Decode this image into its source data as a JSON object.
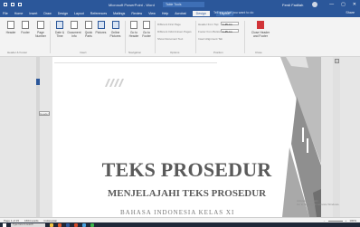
{
  "app": {
    "window_title": "Microsoft PowerPoint - Word",
    "context_tab": "Table Tools",
    "user": "Ferdi Fadilah",
    "window_controls": [
      "—",
      "▢",
      "✕"
    ]
  },
  "tabs": [
    "File",
    "Home",
    "Insert",
    "Draw",
    "Design",
    "Layout",
    "References",
    "Mailings",
    "Review",
    "View",
    "Help",
    "Acrobat",
    "Design",
    "Layout"
  ],
  "tell_me": "Tell me what you want to do",
  "share_label": "Share",
  "ribbon": {
    "buttons": [
      "Header",
      "Footer",
      "Page Number",
      "Date & Time",
      "Document Info",
      "Quick Parts",
      "Pictures",
      "Online Pictures",
      "Go to Header",
      "Go to Footer",
      "Close Header and Footer"
    ],
    "options": [
      "Different First Page",
      "Different Odd & Even Pages",
      "Show Document Text"
    ],
    "position": [
      "Header from Top:",
      "Footer from Bottom:",
      "Insert Alignment Tab"
    ],
    "position_values": [
      "1.25 cm",
      "1.25 cm"
    ],
    "groups": [
      "Header & Footer",
      "Insert",
      "Navigation",
      "Options",
      "Position",
      "Close"
    ]
  },
  "document": {
    "title": "TEKS PROSEDUR",
    "subtitle": "MENJELAJAHI TEKS PROSEDUR",
    "cut_line": "BAHASA INDONESIA KELAS XI",
    "side_label": "Header"
  },
  "activate": {
    "line1": "Activate Windows",
    "line2": "Go to Settings to activate Windows."
  },
  "status": {
    "page": "Page 1 of 15",
    "words": "1664 words",
    "language": "Indonesian",
    "zoom": "100%"
  },
  "taskbar": {
    "search_placeholder": "Type here to search"
  },
  "colors": {
    "accent": "#2b579a",
    "close_button": "#d13438"
  }
}
